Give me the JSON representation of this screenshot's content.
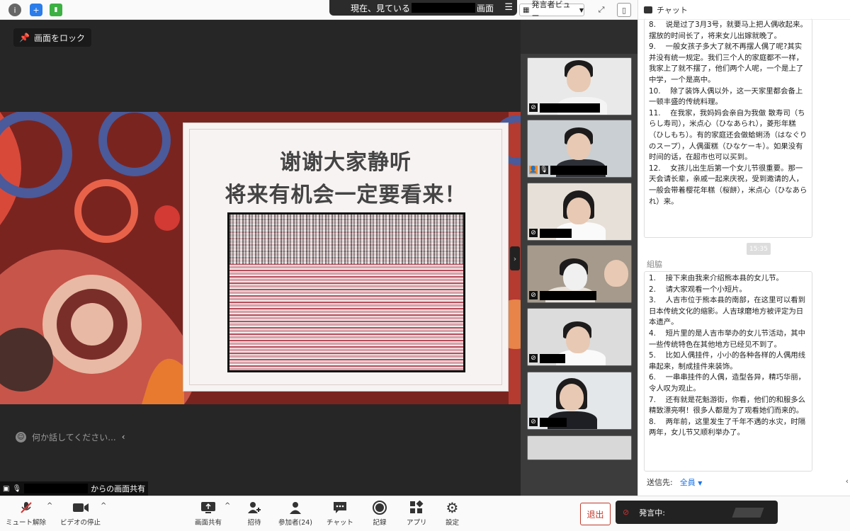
{
  "topbar": {
    "viewing_prefix": "現在、見ている",
    "viewing_suffix": "画面",
    "view_mode": "発言者ビュー",
    "icons": [
      "info-icon",
      "shield-icon",
      "signal-icon",
      "menu-icon",
      "fullscreen-icon",
      "panel-icon"
    ]
  },
  "stage": {
    "lock_label": "画面をロック",
    "slide_title_1": "谢谢大家静听",
    "slide_title_2": "将来有机会一定要看来！",
    "chat_placeholder": "何か話してください...",
    "share_suffix": "からの画面共有"
  },
  "chat": {
    "title": "チャット",
    "msg1": [
      "8.　 说是过了3月3号，就要马上把人偶收起来。摆放的时间长了，将来女儿出嫁就晚了。",
      "9.　 一般女孩子多大了就不再摆人偶了呢?其实并没有统一规定。我们三个人的家庭都不一样，我家上了就不摆了，他们两个人呢，一个是上了中学，一个是高中。",
      "10.　 除了装饰人偶以外，这一天家里都会备上一顿丰盛的传统料理。",
      "11.　 在我家，我妈妈会亲自为我做 散寿司（ちらし寿司），米点心（ひなあられ），菱形年糕（ひしもち）。有的家庭还会做蛤蜊汤（はなぐりのスープ），人偶蛋糕（ひなケーキ）。如果没有时间的话，在超市也可以买到。",
      "12.　 女孩儿出生后第一个女儿节很重要。那一天会请长辈，亲戚一起来庆祝，受到邀请的人，一般会带着樱花年糕（桜餅），米点心（ひなあられ）来。"
    ],
    "time": "15:35",
    "sender": "組脇",
    "msg2": [
      "1.　 接下来由我来介绍熊本县的女儿节。",
      "2.　 请大家观看一个小短片。",
      "3.　 人吉市位于熊本县的南部，在这里可以看到日本传统文化的缩影。人吉球磨地方被评定为日本遗产。",
      "4.　 短片里的是人吉市举办的女儿节活动，其中一些传统特色在其他地方已经见不到了。",
      "5.　 比如人偶挂件，小小的各种各样的人偶用线串起来，制成挂件来装饰。",
      "6.　 一串串挂件的人偶，造型各异，精巧华丽，令人叹为观止。",
      "7.　 还有就是花魁游街，你看，他们的和服多么精致漂亮啊！很多人都是为了观看她们而来的。",
      "8.　 两年前，这里发生了千年不遇的水灾，时隔两年，女儿节又顺利举办了。"
    ],
    "send_to_label": "送信先:",
    "send_to_target": "全員"
  },
  "toolbar": {
    "mute": "ミュート解除",
    "video": "ビデオの停止",
    "share": "画面共有",
    "invite": "招待",
    "participants": "参加者(24)",
    "chat": "チャット",
    "record": "記録",
    "apps": "アプリ",
    "settings": "設定",
    "leave": "退出",
    "speaking": "発言中:"
  }
}
